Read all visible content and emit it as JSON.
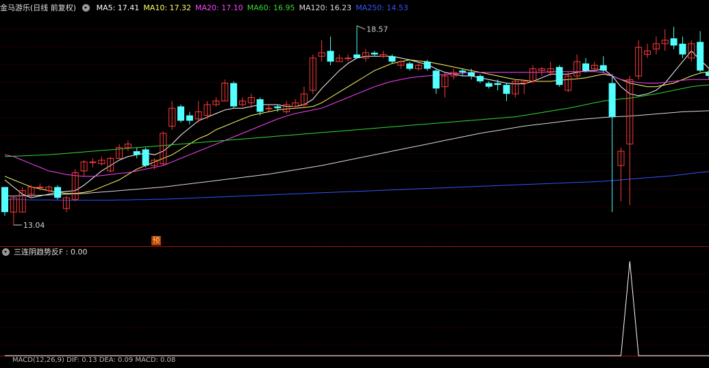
{
  "header": {
    "title": "金马游乐(日线 前复权)",
    "ma": [
      {
        "label": "MA5: 17.41",
        "color": "#ffffff"
      },
      {
        "label": "MA10: 17.32",
        "color": "#ffff66"
      },
      {
        "label": "MA20: 17.10",
        "color": "#ff44ff"
      },
      {
        "label": "MA60: 16.95",
        "color": "#33dd33"
      },
      {
        "label": "MA120: 16.23",
        "color": "#dddddd"
      },
      {
        "label": "MA250: 14.53",
        "color": "#3355ff"
      }
    ]
  },
  "indicator": {
    "label": "三连阴趋势反F : 0.00",
    "color": "#e0e0e0"
  },
  "bottom_partial": {
    "label": "MACD(12,26,9) DIF: 0.13  DEA: 0.09  MACD: 0.08"
  },
  "marker": {
    "label": "预"
  },
  "colors": {
    "up": "#ff3b3b",
    "down": "#54ffff",
    "grid": "#6a0000",
    "axis": "#a01010"
  },
  "chart_data": [
    {
      "type": "candlestick",
      "ylim": [
        12.6,
        18.9
      ],
      "max_label": "18.57",
      "min_label": "13.04",
      "candles": [
        [
          14.1,
          13.4,
          14.1,
          13.3
        ],
        [
          13.4,
          13.8,
          13.85,
          13.04
        ],
        [
          13.4,
          14.0,
          14.1,
          13.4
        ],
        [
          13.9,
          14.1,
          14.15,
          13.8
        ],
        [
          14.1,
          14.1,
          14.2,
          14.0
        ],
        [
          14.0,
          14.1,
          14.15,
          13.95
        ],
        [
          14.1,
          13.8,
          14.15,
          13.75
        ],
        [
          13.5,
          13.8,
          13.85,
          13.4
        ],
        [
          13.75,
          14.5,
          14.6,
          13.7
        ],
        [
          14.55,
          14.8,
          14.85,
          14.4
        ],
        [
          14.8,
          14.8,
          14.9,
          14.65
        ],
        [
          14.75,
          14.85,
          14.95,
          14.7
        ],
        [
          14.55,
          14.9,
          14.95,
          14.5
        ],
        [
          14.9,
          15.2,
          15.3,
          14.9
        ],
        [
          15.2,
          15.3,
          15.4,
          15.1
        ],
        [
          15.1,
          15.0,
          15.2,
          14.9
        ],
        [
          15.15,
          14.7,
          15.2,
          14.65
        ],
        [
          14.7,
          14.85,
          14.9,
          14.6
        ],
        [
          14.75,
          15.6,
          15.65,
          14.7
        ],
        [
          15.8,
          16.3,
          16.5,
          15.7
        ],
        [
          16.35,
          15.95,
          16.4,
          15.9
        ],
        [
          16.1,
          15.95,
          16.2,
          15.85
        ],
        [
          16.0,
          16.2,
          16.5,
          15.9
        ],
        [
          16.1,
          16.4,
          16.5,
          16.0
        ],
        [
          16.4,
          16.5,
          16.6,
          16.35
        ],
        [
          16.5,
          17.0,
          17.1,
          16.5
        ],
        [
          17.0,
          16.35,
          17.05,
          16.3
        ],
        [
          16.4,
          16.5,
          16.6,
          16.35
        ],
        [
          16.45,
          16.6,
          16.7,
          16.3
        ],
        [
          16.55,
          16.2,
          16.6,
          16.1
        ],
        [
          16.3,
          16.3,
          16.4,
          16.2
        ],
        [
          16.35,
          16.3,
          16.4,
          16.2
        ],
        [
          16.2,
          16.4,
          16.5,
          16.15
        ],
        [
          16.35,
          16.45,
          16.55,
          16.3
        ],
        [
          16.4,
          16.7,
          16.9,
          16.3
        ],
        [
          16.8,
          17.7,
          17.8,
          16.7
        ],
        [
          17.75,
          17.85,
          18.2,
          17.6
        ],
        [
          17.9,
          17.6,
          18.3,
          17.5
        ],
        [
          17.6,
          17.7,
          17.8,
          17.6
        ],
        [
          17.7,
          17.7,
          17.8,
          17.6
        ],
        [
          17.8,
          17.7,
          18.6,
          17.7
        ],
        [
          17.7,
          17.85,
          17.95,
          17.6
        ],
        [
          17.85,
          17.8,
          17.9,
          17.75
        ],
        [
          17.75,
          17.8,
          17.9,
          17.7
        ],
        [
          17.75,
          17.6,
          17.8,
          17.55
        ],
        [
          17.5,
          17.6,
          17.65,
          17.4
        ],
        [
          17.55,
          17.4,
          17.6,
          17.35
        ],
        [
          17.4,
          17.5,
          17.55,
          17.35
        ],
        [
          17.6,
          17.4,
          17.65,
          17.35
        ],
        [
          17.35,
          16.85,
          17.4,
          16.7
        ],
        [
          16.9,
          17.2,
          17.3,
          16.6
        ],
        [
          17.2,
          17.3,
          17.4,
          17.1
        ],
        [
          17.35,
          17.3,
          17.4,
          17.2
        ],
        [
          17.3,
          17.2,
          17.4,
          17.1
        ],
        [
          17.2,
          17.05,
          17.25,
          17.0
        ],
        [
          17.0,
          16.9,
          17.05,
          16.85
        ],
        [
          17.0,
          16.95,
          17.1,
          16.8
        ],
        [
          16.95,
          16.7,
          17.0,
          16.5
        ],
        [
          16.7,
          17.05,
          17.1,
          16.6
        ],
        [
          17.0,
          17.05,
          17.1,
          16.7
        ],
        [
          17.05,
          17.4,
          17.5,
          17.0
        ],
        [
          17.35,
          17.4,
          17.45,
          17.2
        ],
        [
          17.3,
          17.4,
          17.6,
          17.2
        ],
        [
          17.45,
          16.95,
          17.5,
          16.9
        ],
        [
          16.8,
          17.2,
          17.3,
          16.75
        ],
        [
          17.2,
          17.6,
          17.8,
          17.1
        ],
        [
          17.55,
          17.35,
          17.7,
          17.3
        ],
        [
          17.4,
          17.5,
          17.6,
          17.35
        ],
        [
          17.5,
          17.35,
          17.75,
          17.3
        ],
        [
          17.0,
          16.05,
          17.25,
          13.4
        ],
        [
          14.7,
          15.1,
          15.2,
          13.7
        ],
        [
          15.3,
          17.1,
          17.2,
          13.6
        ],
        [
          17.2,
          18.0,
          18.2,
          17.1
        ],
        [
          17.8,
          17.9,
          18.1,
          17.7
        ],
        [
          17.95,
          18.1,
          18.3,
          17.8
        ],
        [
          18.1,
          18.2,
          18.5,
          17.9
        ],
        [
          18.25,
          18.05,
          18.57,
          17.95
        ],
        [
          18.1,
          17.8,
          18.3,
          17.7
        ],
        [
          17.7,
          18.1,
          18.2,
          17.6
        ],
        [
          18.15,
          17.35,
          18.45,
          17.3
        ],
        [
          17.3,
          17.2,
          17.4,
          17.1
        ]
      ],
      "ma_series": [
        {
          "name": "MA5",
          "color": "#ffffff",
          "values": [
            14.3,
            14.1,
            13.9,
            13.8,
            13.85,
            13.9,
            13.95,
            13.98,
            14.0,
            14.15,
            14.35,
            14.55,
            14.7,
            14.85,
            14.95,
            15.0,
            15.05,
            15.0,
            15.1,
            15.3,
            15.55,
            15.75,
            15.95,
            16.05,
            16.15,
            16.25,
            16.3,
            16.3,
            16.35,
            16.4,
            16.4,
            16.4,
            16.35,
            16.35,
            16.4,
            16.55,
            16.85,
            17.1,
            17.35,
            17.55,
            17.7,
            17.75,
            17.75,
            17.75,
            17.75,
            17.7,
            17.65,
            17.58,
            17.52,
            17.4,
            17.3,
            17.25,
            17.2,
            17.2,
            17.15,
            17.1,
            17.05,
            17.0,
            16.98,
            16.98,
            17.05,
            17.15,
            17.25,
            17.25,
            17.25,
            17.3,
            17.35,
            17.35,
            17.4,
            17.2,
            16.9,
            16.7,
            16.65,
            16.7,
            16.8,
            17.0,
            17.3,
            17.6,
            17.9,
            17.65,
            17.41
          ]
        },
        {
          "name": "MA10",
          "color": "#ffff66",
          "values": [
            14.4,
            14.3,
            14.2,
            14.1,
            14.05,
            14.0,
            13.95,
            13.92,
            13.92,
            13.95,
            14.0,
            14.1,
            14.2,
            14.3,
            14.45,
            14.6,
            14.7,
            14.8,
            14.9,
            15.0,
            15.15,
            15.3,
            15.45,
            15.55,
            15.7,
            15.8,
            15.9,
            16.0,
            16.1,
            16.15,
            16.2,
            16.25,
            16.28,
            16.3,
            16.32,
            16.35,
            16.45,
            16.6,
            16.75,
            16.9,
            17.05,
            17.2,
            17.35,
            17.45,
            17.55,
            17.6,
            17.65,
            17.62,
            17.6,
            17.55,
            17.5,
            17.45,
            17.4,
            17.35,
            17.3,
            17.25,
            17.2,
            17.15,
            17.1,
            17.08,
            17.05,
            17.05,
            17.05,
            17.08,
            17.1,
            17.12,
            17.15,
            17.2,
            17.25,
            17.2,
            17.1,
            17.0,
            16.95,
            16.9,
            16.9,
            16.95,
            17.0,
            17.1,
            17.2,
            17.28,
            17.32
          ]
        },
        {
          "name": "MA20",
          "color": "#ff44ff",
          "values": [
            15.0,
            14.95,
            14.85,
            14.75,
            14.65,
            14.55,
            14.5,
            14.45,
            14.42,
            14.4,
            14.4,
            14.42,
            14.45,
            14.48,
            14.5,
            14.55,
            14.6,
            14.65,
            14.7,
            14.8,
            14.9,
            15.0,
            15.1,
            15.2,
            15.3,
            15.4,
            15.5,
            15.6,
            15.7,
            15.8,
            15.9,
            16.0,
            16.08,
            16.15,
            16.2,
            16.25,
            16.3,
            16.4,
            16.5,
            16.6,
            16.7,
            16.8,
            16.9,
            16.98,
            17.05,
            17.1,
            17.15,
            17.18,
            17.2,
            17.22,
            17.24,
            17.26,
            17.28,
            17.3,
            17.3,
            17.3,
            17.3,
            17.3,
            17.3,
            17.3,
            17.3,
            17.3,
            17.32,
            17.32,
            17.32,
            17.32,
            17.32,
            17.32,
            17.3,
            17.2,
            17.1,
            17.05,
            17.02,
            17.0,
            17.0,
            17.02,
            17.05,
            17.08,
            17.1,
            17.1,
            17.1
          ]
        },
        {
          "name": "MA60",
          "color": "#33dd33",
          "values": [
            14.95,
            14.96,
            14.97,
            14.98,
            14.99,
            15.0,
            15.02,
            15.04,
            15.06,
            15.08,
            15.1,
            15.12,
            15.14,
            15.16,
            15.18,
            15.2,
            15.22,
            15.24,
            15.26,
            15.28,
            15.3,
            15.32,
            15.34,
            15.36,
            15.38,
            15.4,
            15.42,
            15.44,
            15.46,
            15.48,
            15.5,
            15.52,
            15.54,
            15.56,
            15.58,
            15.6,
            15.62,
            15.64,
            15.66,
            15.68,
            15.7,
            15.72,
            15.74,
            15.76,
            15.78,
            15.8,
            15.82,
            15.84,
            15.86,
            15.88,
            15.9,
            15.92,
            15.94,
            15.96,
            15.98,
            16.0,
            16.02,
            16.04,
            16.06,
            16.1,
            16.14,
            16.18,
            16.22,
            16.26,
            16.3,
            16.35,
            16.4,
            16.45,
            16.5,
            16.53,
            16.56,
            16.58,
            16.62,
            16.66,
            16.7,
            16.75,
            16.8,
            16.85,
            16.9,
            16.93,
            16.95
          ]
        },
        {
          "name": "MA120",
          "color": "#dddddd",
          "values": [
            13.85,
            13.85,
            13.86,
            13.86,
            13.87,
            13.88,
            13.89,
            13.9,
            13.91,
            13.92,
            13.94,
            13.96,
            13.98,
            14.0,
            14.02,
            14.04,
            14.06,
            14.08,
            14.1,
            14.13,
            14.16,
            14.19,
            14.22,
            14.25,
            14.28,
            14.31,
            14.34,
            14.37,
            14.4,
            14.43,
            14.46,
            14.5,
            14.54,
            14.58,
            14.62,
            14.66,
            14.7,
            14.75,
            14.8,
            14.85,
            14.9,
            14.95,
            15.0,
            15.05,
            15.1,
            15.15,
            15.2,
            15.25,
            15.3,
            15.35,
            15.4,
            15.45,
            15.5,
            15.55,
            15.6,
            15.64,
            15.68,
            15.72,
            15.76,
            15.8,
            15.83,
            15.86,
            15.89,
            15.92,
            15.95,
            15.98,
            16.0,
            16.02,
            16.04,
            16.06,
            16.07,
            16.08,
            16.1,
            16.12,
            16.14,
            16.16,
            16.18,
            16.2,
            16.21,
            16.22,
            16.23
          ]
        },
        {
          "name": "MA250",
          "color": "#3355ff",
          "values": [
            13.75,
            13.75,
            13.75,
            13.74,
            13.74,
            13.74,
            13.73,
            13.73,
            13.73,
            13.73,
            13.73,
            13.73,
            13.73,
            13.74,
            13.74,
            13.75,
            13.75,
            13.76,
            13.76,
            13.77,
            13.78,
            13.79,
            13.8,
            13.81,
            13.82,
            13.83,
            13.84,
            13.85,
            13.86,
            13.87,
            13.88,
            13.89,
            13.9,
            13.91,
            13.92,
            13.93,
            13.94,
            13.95,
            13.96,
            13.97,
            13.98,
            13.99,
            14.0,
            14.01,
            14.02,
            14.03,
            14.04,
            14.05,
            14.06,
            14.07,
            14.08,
            14.09,
            14.1,
            14.11,
            14.12,
            14.13,
            14.14,
            14.15,
            14.16,
            14.17,
            14.18,
            14.19,
            14.2,
            14.21,
            14.22,
            14.23,
            14.24,
            14.25,
            14.26,
            14.28,
            14.3,
            14.32,
            14.34,
            14.36,
            14.38,
            14.4,
            14.42,
            14.45,
            14.48,
            14.51,
            14.53
          ]
        }
      ]
    },
    {
      "type": "line",
      "name": "三连阴趋势反F",
      "ylim": [
        0,
        1
      ],
      "values": [
        0,
        0,
        0,
        0,
        0,
        0,
        0,
        0,
        0,
        0,
        0,
        0,
        0,
        0,
        0,
        0,
        0,
        0,
        0,
        0,
        0,
        0,
        0,
        0,
        0,
        0,
        0,
        0,
        0,
        0,
        0,
        0,
        0,
        0,
        0,
        0,
        0,
        0,
        0,
        0,
        0,
        0,
        0,
        0,
        0,
        0,
        0,
        0,
        0,
        0,
        0,
        0,
        0,
        0,
        0,
        0,
        0,
        0,
        0,
        0,
        0,
        0,
        0,
        0,
        0,
        0,
        0,
        0,
        0,
        0,
        0,
        1,
        0,
        0,
        0,
        0,
        0,
        0,
        0,
        0,
        0
      ]
    }
  ]
}
